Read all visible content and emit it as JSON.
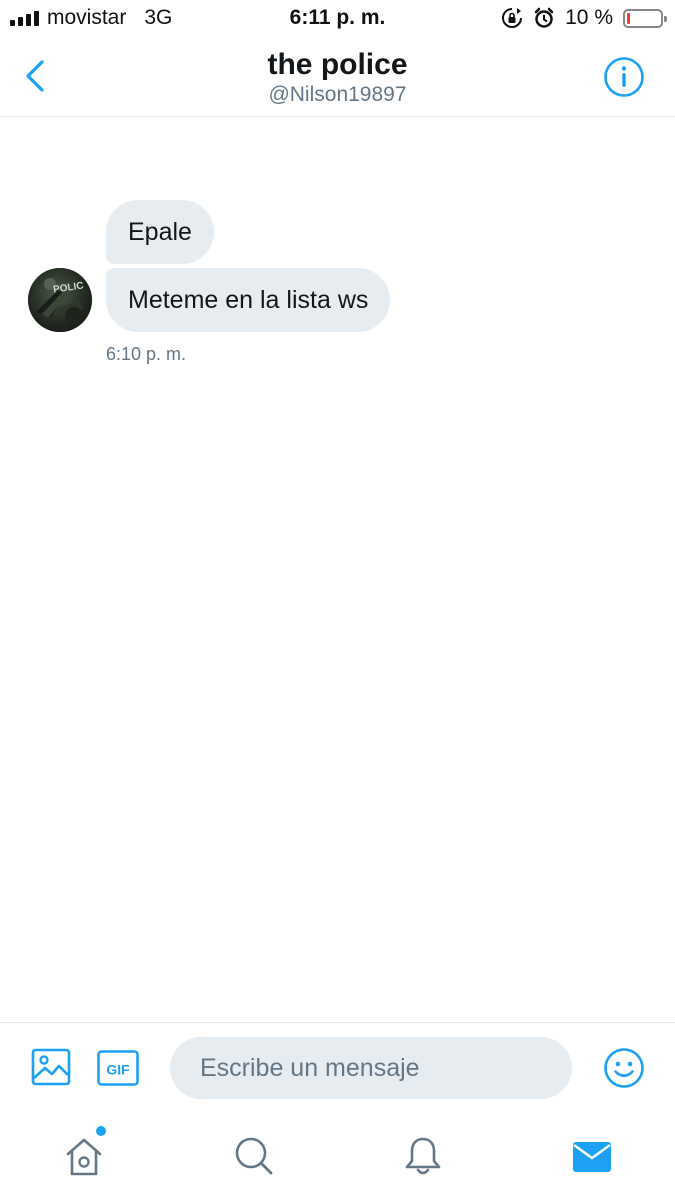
{
  "status_bar": {
    "carrier": "movistar",
    "network": "3G",
    "time": "6:11 p. m.",
    "battery_text": "10 %",
    "battery_level": 0.1,
    "icons": [
      "signal-icon",
      "orientation-lock-icon",
      "alarm-icon",
      "battery-icon"
    ]
  },
  "header": {
    "title": "the police",
    "handle": "@Nilson19897",
    "back_icon": "chevron-left-icon",
    "info_icon": "info-icon"
  },
  "conversation": {
    "avatar_text": "POLIC",
    "messages": [
      {
        "text": "Epale"
      },
      {
        "text": "Meteme en la lista ws"
      }
    ],
    "timestamp": "6:10 p. m."
  },
  "composer": {
    "placeholder": "Escribe un mensaje",
    "value": "",
    "gif_label": "GIF",
    "icons": [
      "image-icon",
      "gif-icon",
      "emoji-icon"
    ]
  },
  "tabbar": {
    "tabs": [
      "home-icon",
      "search-icon",
      "bell-icon",
      "mail-icon"
    ],
    "home_has_notification": true
  },
  "colors": {
    "accent": "#1da1f2",
    "bubble": "#e6ecf0",
    "secondary_text": "#657786",
    "battery_low": "#ff3b30"
  }
}
